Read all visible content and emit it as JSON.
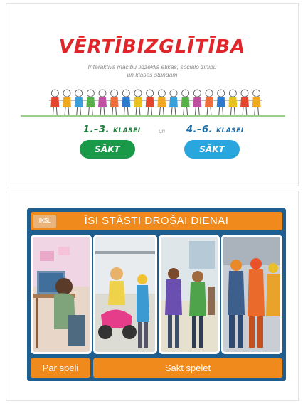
{
  "top_card": {
    "title": "VĒRTĪBIZGLĪTĪBA",
    "subtitle_line1": "Interaktīvs mācību līdzeklis ētikas, sociālo zinību",
    "subtitle_line2": "un klases stundām",
    "grade_left_num": "1.–3.",
    "grade_left_word": "KLASEI",
    "connector": "un",
    "grade_right_num": "4.–6.",
    "grade_right_word": "KLASEI",
    "start_left": "SĀKT",
    "start_right": "SĀKT"
  },
  "bottom_card": {
    "logo": "IKSL",
    "title": "ĪSI STĀSTI DROŠAI DIENAI",
    "about_button": "Par spēli",
    "play_button": "Sākt spēlēt"
  }
}
